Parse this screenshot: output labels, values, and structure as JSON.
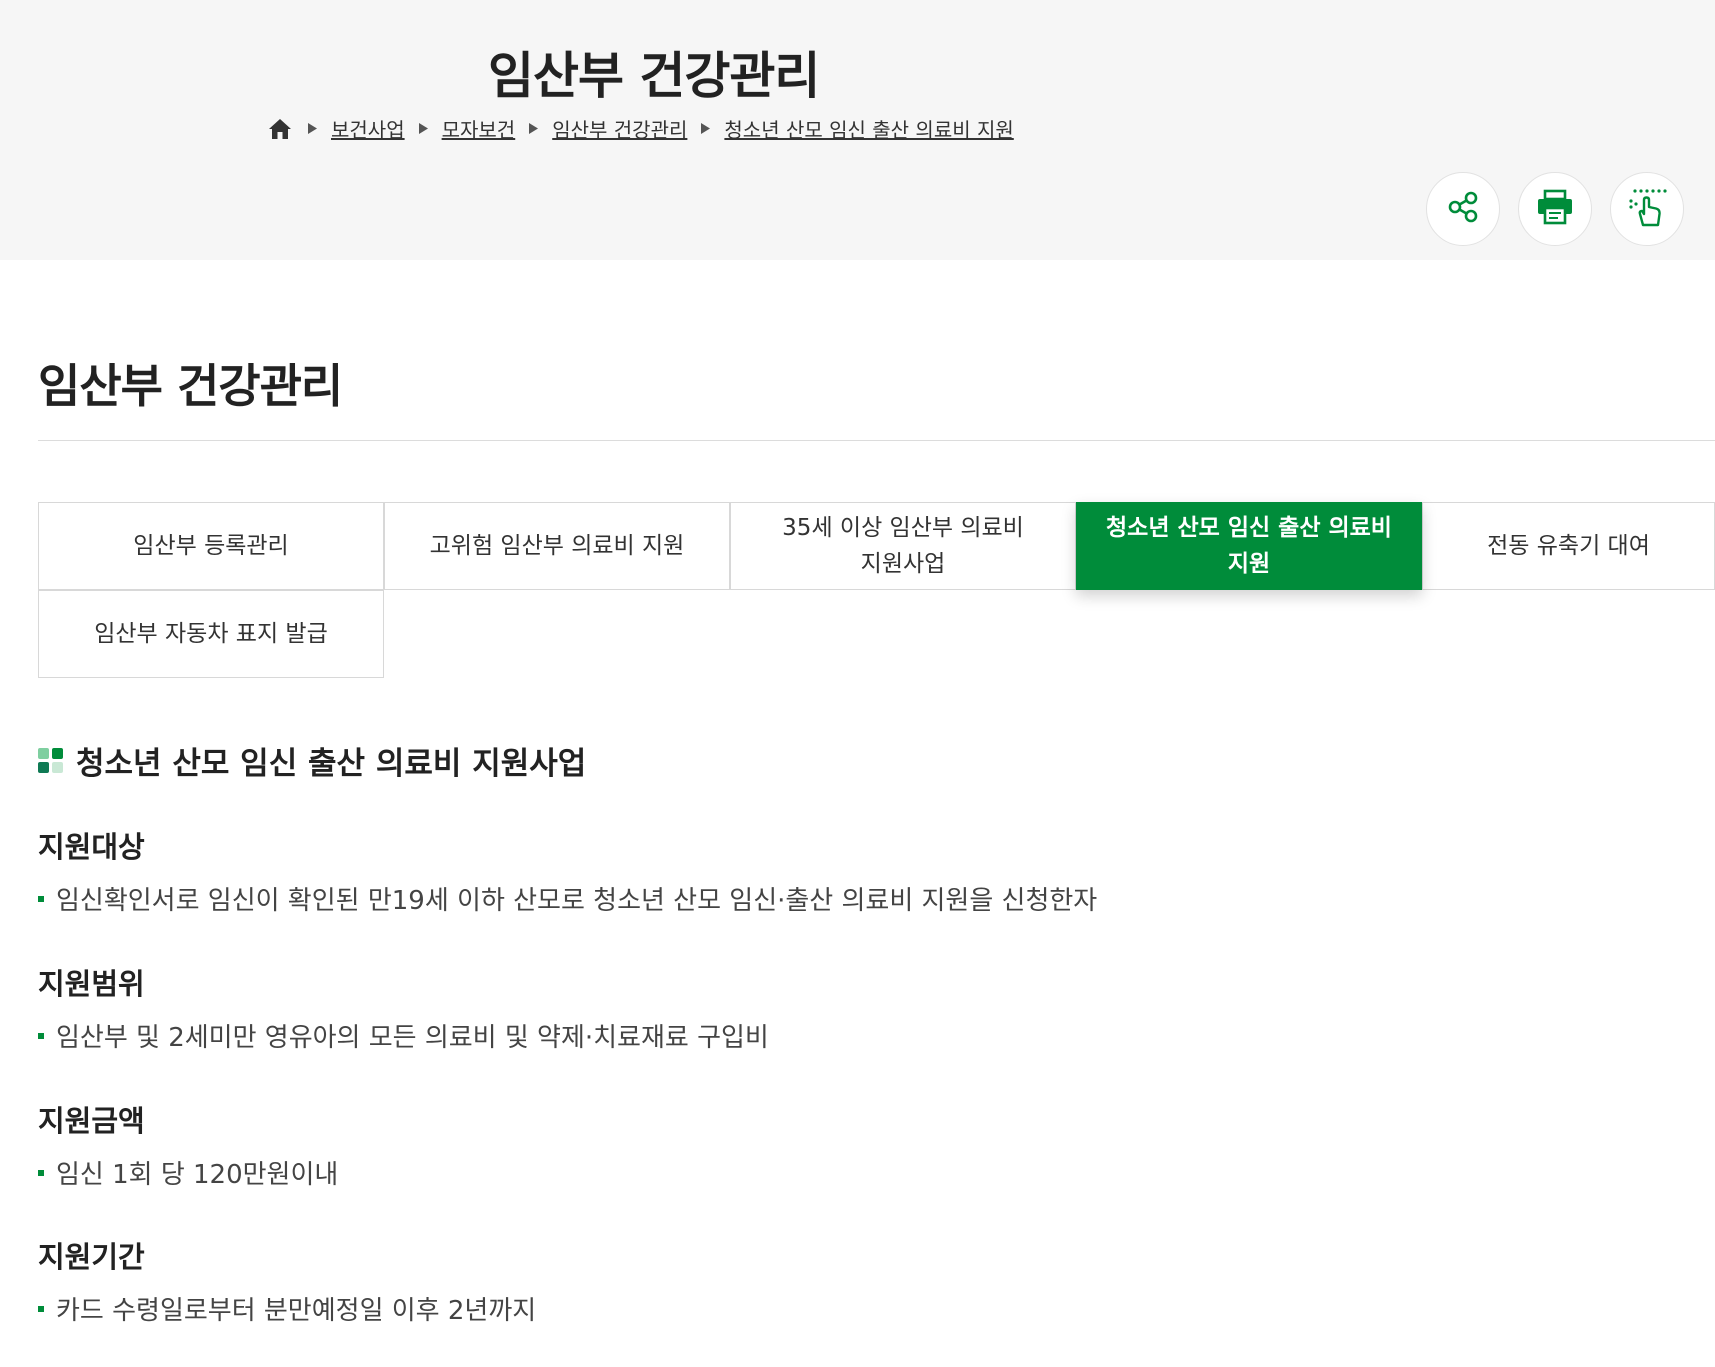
{
  "hero": {
    "title": "임산부 건강관리"
  },
  "breadcrumb": {
    "items": [
      "보건사업",
      "모자보건",
      "임산부 건강관리",
      "청소년 산모 임신 출산 의료비 지원"
    ]
  },
  "tools": {
    "icons": [
      "share-icon",
      "print-icon",
      "braille-touch-icon"
    ]
  },
  "page": {
    "title": "임산부 건강관리"
  },
  "tabs": {
    "items": [
      {
        "label": "임산부 등록관리"
      },
      {
        "label": "고위험 임산부 의료비 지원"
      },
      {
        "label": "35세 이상 임산부 의료비 지원사업"
      },
      {
        "label": "청소년 산모 임신 출산 의료비 지원"
      },
      {
        "label": "전동 유축기 대여"
      },
      {
        "label": "임산부 자동차 표지 발급"
      }
    ],
    "active_index": 3
  },
  "section": {
    "title": "청소년 산모 임신 출산 의료비 지원사업",
    "blocks": [
      {
        "title": "지원대상",
        "text": "임신확인서로 임신이 확인된 만19세 이하 산모로 청소년 산모 임신·출산 의료비 지원을 신청한자"
      },
      {
        "title": "지원범위",
        "text": "임산부 및 2세미만 영유아의 모든 의료비 및 약제·치료재료 구입비"
      },
      {
        "title": "지원금액",
        "text": "임신 1회 당 120만원이내"
      },
      {
        "title": "지원기간",
        "text": "카드 수령일로부터 분만예정일 이후 2년까지"
      }
    ]
  },
  "colors": {
    "accent": "#008c3a",
    "band": "#f6f6f6"
  }
}
